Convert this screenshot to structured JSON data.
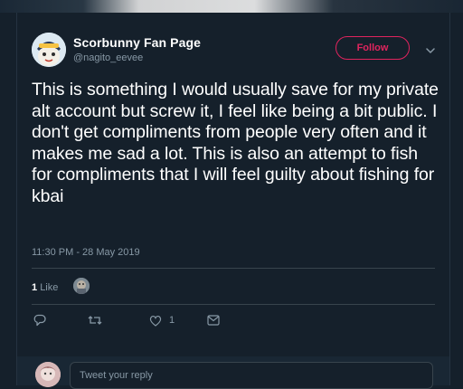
{
  "profile": {
    "display_name": "Scorbunny Fan Page",
    "handle": "@nagito_eevee"
  },
  "follow": {
    "label": "Follow"
  },
  "tweet": {
    "text": "This is something I would usually save for my private alt account but screw it, I feel like being a bit public. I don't get compliments from people very often and it makes me sad a lot. This is also an attempt to fish for compliments that I will feel guilty about fishing for kbai",
    "timestamp": "11:30 PM - 28 May 2019"
  },
  "stats": {
    "likes_count": "1",
    "likes_label": "Like"
  },
  "actions": {
    "like_count": "1"
  },
  "reply": {
    "placeholder": "Tweet your reply"
  },
  "colors": {
    "background": "#15202b",
    "muted_text": "#8899a6",
    "follow_accent": "#e0245e",
    "divider": "#38444d"
  },
  "icons": [
    "chevron-down-icon",
    "reply-icon",
    "retweet-icon",
    "heart-icon",
    "message-icon"
  ]
}
